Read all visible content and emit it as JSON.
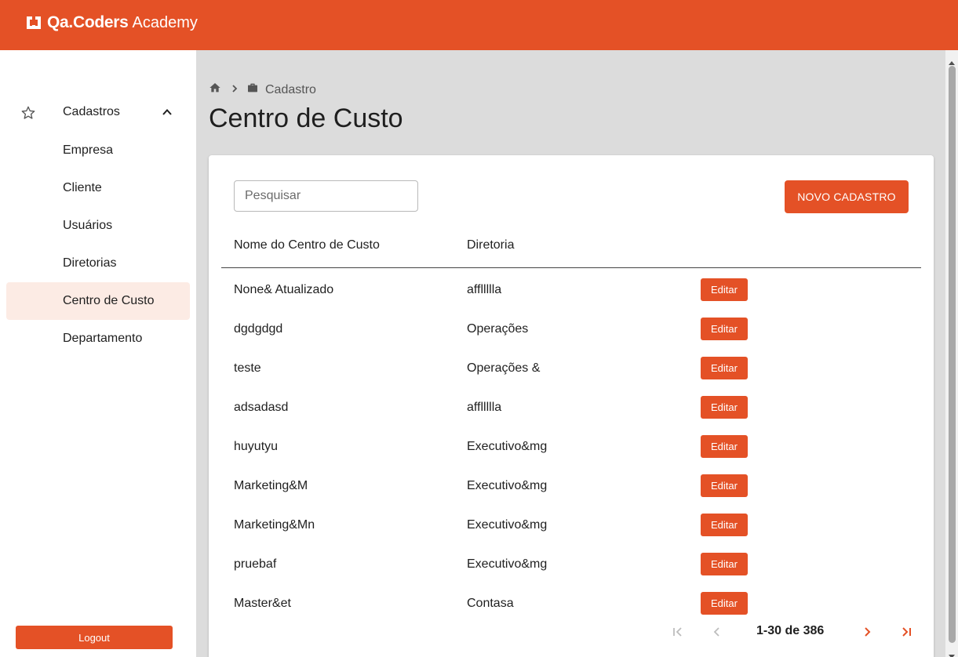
{
  "header": {
    "brand_name": "Qa.Coders",
    "brand_sub": "Academy",
    "color": "#e45126"
  },
  "sidebar": {
    "group_label": "Cadastros",
    "group_icon": "star-outline-icon",
    "items": [
      {
        "label": "Empresa"
      },
      {
        "label": "Cliente"
      },
      {
        "label": "Usuários"
      },
      {
        "label": "Diretorias"
      },
      {
        "label": "Centro de Custo",
        "active": true
      },
      {
        "label": "Departamento"
      }
    ],
    "logout_label": "Logout"
  },
  "breadcrumb": {
    "home_icon": "home-icon",
    "separator_icon": "chevron-right-icon",
    "section_icon": "briefcase-icon",
    "current": "Cadastro"
  },
  "page": {
    "title": "Centro de Custo"
  },
  "toolbar": {
    "search_placeholder": "Pesquisar",
    "new_button": "NOVO CADASTRO"
  },
  "table": {
    "columns": [
      "Nome do Centro de Custo",
      "Diretoria"
    ],
    "edit_label": "Editar",
    "rows": [
      {
        "name": "None& Atualizado",
        "diretoria": "affllllla"
      },
      {
        "name": "dgdgdgd",
        "diretoria": "Operações"
      },
      {
        "name": "teste",
        "diretoria": "Operações &"
      },
      {
        "name": "adsadasd",
        "diretoria": "affllllla"
      },
      {
        "name": "huyutyu",
        "diretoria": "Executivo&mg"
      },
      {
        "name": "Marketing&M",
        "diretoria": "Executivo&mg"
      },
      {
        "name": "Marketing&Mn",
        "diretoria": "Executivo&mg"
      },
      {
        "name": "pruebaf",
        "diretoria": "Executivo&mg"
      },
      {
        "name": "Master&et",
        "diretoria": "Contasa"
      }
    ]
  },
  "pagination": {
    "range": "1-30 de 386",
    "first_icon": "first-page-icon",
    "prev_icon": "chevron-left-icon",
    "next_icon": "chevron-right-icon",
    "last_icon": "last-page-icon"
  }
}
